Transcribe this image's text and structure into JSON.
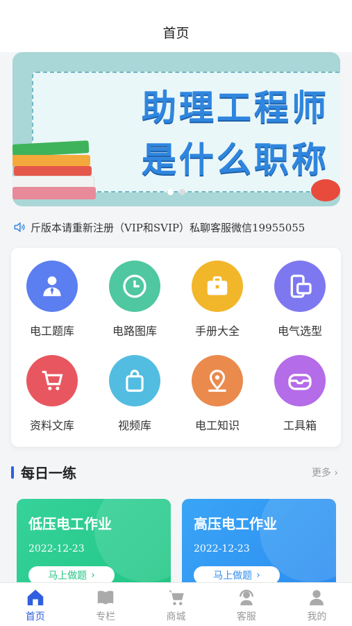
{
  "header": {
    "title": "首页"
  },
  "banner": {
    "line1": "助理工程师",
    "line2": "是什么职称",
    "dots": 2,
    "active_dot": 0
  },
  "notice": {
    "icon": "speaker-icon",
    "text": "斤版本请重新注册（VIP和SVIP）私聊客服微信19955055"
  },
  "grid": {
    "items": [
      {
        "label": "电工题库",
        "icon": "user-tie-icon",
        "color": "#5b7ef0"
      },
      {
        "label": "电路图库",
        "icon": "clock-icon",
        "color": "#4fc7a0"
      },
      {
        "label": "手册大全",
        "icon": "briefcase-icon",
        "color": "#f2b62a"
      },
      {
        "label": "电气选型",
        "icon": "devices-icon",
        "color": "#7e78f0"
      },
      {
        "label": "资料文库",
        "icon": "cart-icon",
        "color": "#e8575f"
      },
      {
        "label": "视频库",
        "icon": "bag-icon",
        "color": "#52bde0"
      },
      {
        "label": "电工知识",
        "icon": "map-pin-icon",
        "color": "#ea8a4d"
      },
      {
        "label": "工具箱",
        "icon": "toolbox-icon",
        "color": "#b46ce8"
      }
    ]
  },
  "daily": {
    "title": "每日一练",
    "more": "更多",
    "cards": [
      {
        "title": "低压电工作业",
        "date": "2022-12-23",
        "button": "马上做题"
      },
      {
        "title": "高压电工作业",
        "date": "2022-12-23",
        "button": "马上做题"
      }
    ]
  },
  "tabbar": {
    "active_color": "#2f5fe0",
    "tabs": [
      {
        "label": "首页",
        "icon": "home-icon"
      },
      {
        "label": "专栏",
        "icon": "book-icon"
      },
      {
        "label": "商城",
        "icon": "cart-icon"
      },
      {
        "label": "客服",
        "icon": "headset-icon"
      },
      {
        "label": "我的",
        "icon": "person-icon"
      }
    ]
  }
}
